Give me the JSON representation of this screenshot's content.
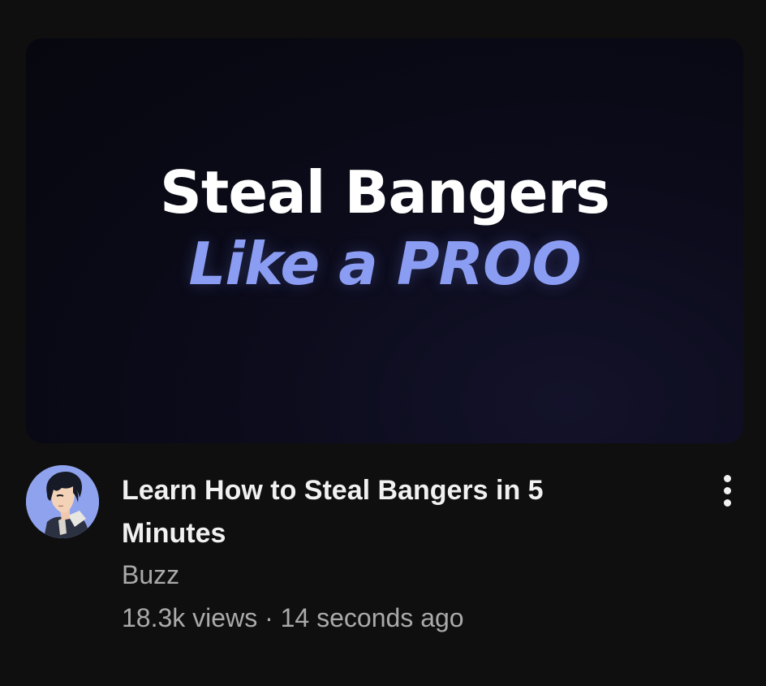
{
  "video": {
    "thumbnail": {
      "line1": "Steal Bangers",
      "line2": "Like a PROO"
    },
    "title": "Learn How to Steal Bangers in 5 Minutes",
    "channel": "Buzz",
    "views": "18.3k views",
    "separator": "·",
    "age": "14 seconds ago"
  },
  "icons": {
    "menu": "more-vert-icon",
    "avatar": "channel-avatar"
  },
  "colors": {
    "background": "#0f0f0f",
    "thumbnail_accent": "#8a9df2",
    "avatar_bg": "#8fa2ee",
    "title_text": "#f1f1f1",
    "secondary_text": "#aaaaaa"
  }
}
